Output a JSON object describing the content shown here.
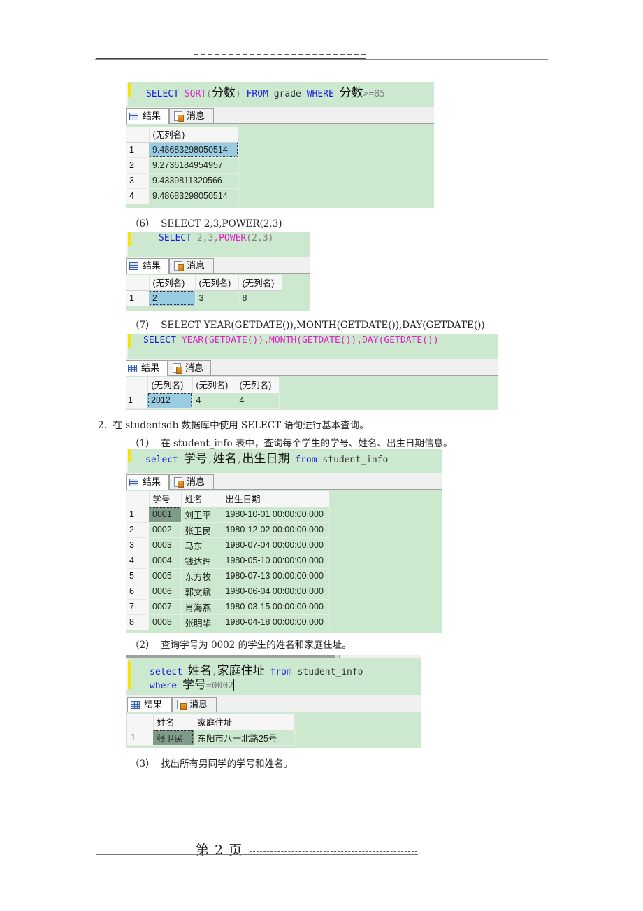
{
  "header": {
    "decoration": "dashed-rule"
  },
  "footer": {
    "page_label": "第 2 页"
  },
  "tabs": {
    "results": "结果",
    "messages": "消息"
  },
  "items": {
    "sqrt_query": {
      "sql_parts": [
        "SELECT",
        " ",
        "SQRT",
        "(",
        "分数",
        ") ",
        "FROM",
        " grade ",
        "WHERE",
        " ",
        "分数",
        ">=85"
      ],
      "columns": [
        "(无列名)"
      ],
      "rows": [
        {
          "n": "1",
          "cells": [
            "9.48683298050514"
          ]
        },
        {
          "n": "2",
          "cells": [
            "9.2736184954957"
          ]
        },
        {
          "n": "3",
          "cells": [
            "9.4339811320566"
          ]
        },
        {
          "n": "4",
          "cells": [
            "9.48683298050514"
          ]
        }
      ]
    },
    "power_query": {
      "label_num": "（6）",
      "label_text": "SELECT 2,3,POWER(2,3)",
      "sql_parts": [
        "SELECT",
        " 2,3,",
        "POWER",
        "(2,3)"
      ],
      "columns": [
        "(无列名)",
        "(无列名)",
        "(无列名)"
      ],
      "rows": [
        {
          "n": "1",
          "cells": [
            "2",
            "3",
            "8"
          ]
        }
      ]
    },
    "date_query": {
      "label_num": "（7）",
      "label_text": "SELECT YEAR(GETDATE()),MONTH(GETDATE()),DAY(GETDATE())",
      "sql_parts": [
        "SELECT",
        " ",
        "YEAR(GETDATE()),MONTH(GETDATE()),DAY(GETDATE())"
      ],
      "columns": [
        "(无列名)",
        "(无列名)",
        "(无列名)"
      ],
      "rows": [
        {
          "n": "1",
          "cells": [
            "2012",
            "4",
            "4"
          ]
        }
      ]
    }
  },
  "section2": {
    "number": "2.",
    "title": "在 studentsdb 数据库中使用 SELECT 语句进行基本查询。",
    "q1": {
      "label_num": "（1）",
      "label_text": "在 student_info 表中，查询每个学生的学号、姓名、出生日期信息。",
      "sql_parts": [
        "select",
        " ",
        "学号",
        ",",
        "姓名",
        ",",
        "出生日期",
        " ",
        "from",
        " student_info"
      ],
      "columns": [
        "学号",
        "姓名",
        "出生日期"
      ],
      "rows": [
        {
          "n": "1",
          "cells": [
            "0001",
            "刘卫平",
            "1980-10-01 00:00:00.000"
          ]
        },
        {
          "n": "2",
          "cells": [
            "0002",
            "张卫民",
            "1980-12-02 00:00:00.000"
          ]
        },
        {
          "n": "3",
          "cells": [
            "0003",
            "马东",
            "1980-07-04 00:00:00.000"
          ]
        },
        {
          "n": "4",
          "cells": [
            "0004",
            "钱达理",
            "1980-05-10 00:00:00.000"
          ]
        },
        {
          "n": "5",
          "cells": [
            "0005",
            "东方牧",
            "1980-07-13 00:00:00.000"
          ]
        },
        {
          "n": "6",
          "cells": [
            "0006",
            "郭文斌",
            "1980-06-04 00:00:00.000"
          ]
        },
        {
          "n": "7",
          "cells": [
            "0007",
            "肖海燕",
            "1980-03-15 00:00:00.000"
          ]
        },
        {
          "n": "8",
          "cells": [
            "0008",
            "张明华",
            "1980-04-18 00:00:00.000"
          ]
        }
      ]
    },
    "q2": {
      "label_num": "（2）",
      "label_text": "查询学号为 0002 的学生的姓名和家庭住址。",
      "sql_line1": [
        "select",
        " ",
        "姓名",
        ",",
        "家庭住址",
        " ",
        "from",
        " student_info"
      ],
      "sql_line2": [
        "where",
        " ",
        "学号",
        "=0002"
      ],
      "columns": [
        "姓名",
        "家庭住址"
      ],
      "rows": [
        {
          "n": "1",
          "cells": [
            "张卫民",
            "东阳市八一北路25号"
          ]
        }
      ]
    },
    "q3": {
      "label_num": "（3）",
      "label_text": "找出所有男同学的学号和姓名。"
    }
  },
  "colors": {
    "result_bg": "#cce8cf",
    "keyword": "#1a1ae6",
    "function": "#e020c8",
    "selected_cell": "#99cce0",
    "current_line_marker": "#f5e400"
  }
}
